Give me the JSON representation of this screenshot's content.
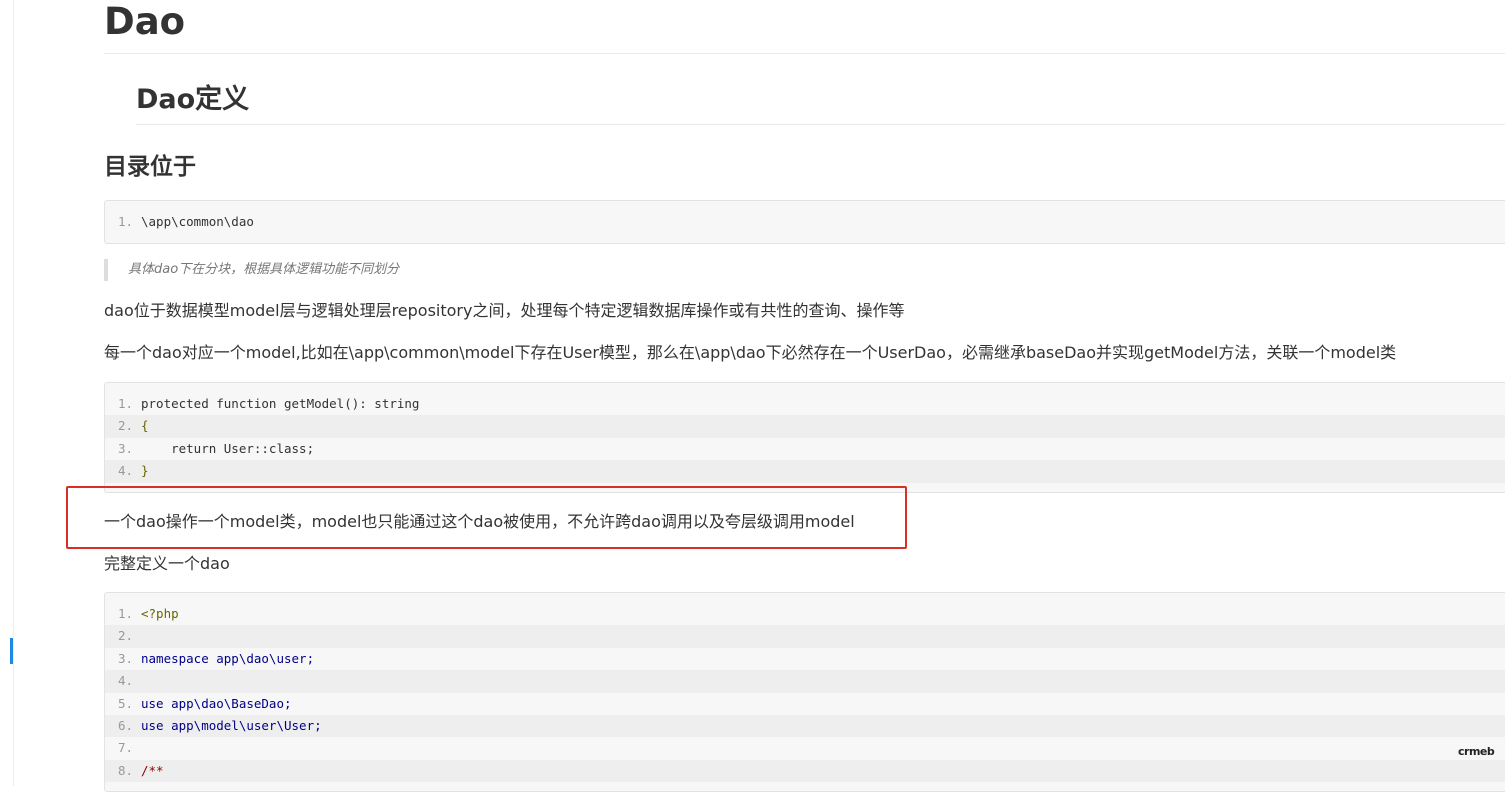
{
  "doc": {
    "title": "Dao",
    "section_title": "Dao定义",
    "subsection_title": "目录位于",
    "dir_code": [
      "\\app\\common\\dao"
    ],
    "quote": "具体dao下在分块，根据具体逻辑功能不同划分",
    "para1": "dao位于数据模型model层与逻辑处理层repository之间，处理每个特定逻辑数据库操作或有共性的查询、操作等",
    "para2": "每一个dao对应一个model,比如在\\app\\common\\model下存在User模型，那么在\\app\\dao下必然存在一个UserDao，必需继承baseDao并实现getModel方法，关联一个model类",
    "method_code": [
      "protected function getModel(): string",
      "{",
      "    return User::class;",
      "}"
    ],
    "highlight_text": "一个dao操作一个model类，model也只能通过这个dao被使用，不允许跨dao调用以及夸层级调用model",
    "para3": "完整定义一个dao",
    "full_code": [
      "<?php",
      "",
      "namespace app\\dao\\user;",
      "",
      "use app\\dao\\BaseDao;",
      "use app\\model\\user\\User;",
      "",
      "/**"
    ],
    "line_numbers": [
      "1",
      "2",
      "3",
      "4",
      "5",
      "6",
      "7",
      "8"
    ]
  },
  "watermark": "crmeb",
  "colors": {
    "highlight_border": "#d93025",
    "code_background": "#f7f7f7",
    "rail_marker": "#1e88e5"
  }
}
